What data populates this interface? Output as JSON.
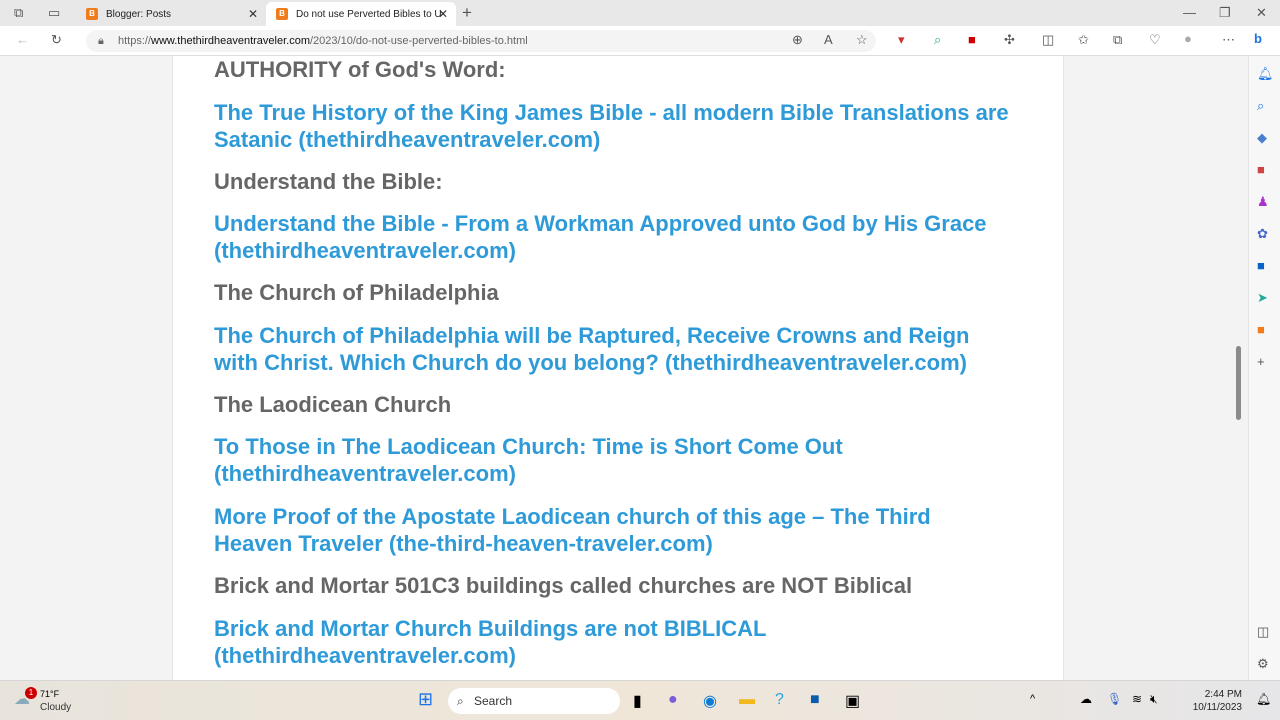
{
  "browser": {
    "tabs": [
      {
        "label": "Blogger: Posts",
        "active": false
      },
      {
        "label": "Do not use Perverted Bibles to U",
        "active": true
      }
    ],
    "url_prefix": "https://",
    "url_domain": "www.thethirdheaventraveler.com",
    "url_path": "/2023/10/do-not-use-perverted-bibles-to.html"
  },
  "content": [
    {
      "type": "heading",
      "text": "AUTHORITY of God's Word:"
    },
    {
      "type": "link",
      "text": "The True History of the King James Bible - all modern Bible Translations are Satanic (thethirdheaventraveler.com)"
    },
    {
      "type": "heading",
      "text": "Understand the Bible:"
    },
    {
      "type": "link",
      "text": "Understand the Bible - From a Workman Approved unto God by His Grace (thethirdheaventraveler.com)"
    },
    {
      "type": "heading",
      "text": "The Church of Philadelphia"
    },
    {
      "type": "link",
      "text": "The Church of Philadelphia will be Raptured, Receive Crowns and Reign with Christ. Which Church do you belong? (thethirdheaventraveler.com)"
    },
    {
      "type": "heading",
      "text": "The Laodicean Church"
    },
    {
      "type": "link",
      "text": "To Those in The Laodicean Church: Time is Short Come Out (thethirdheaventraveler.com)"
    },
    {
      "type": "link",
      "text": "More Proof of the Apostate Laodicean church of this age – The Third Heaven Traveler (the-third-heaven-traveler.com)"
    },
    {
      "type": "heading",
      "text": "Brick and Mortar 501C3 buildings called churches are NOT Biblical"
    },
    {
      "type": "link",
      "text": "Brick and Mortar Church Buildings are not BIBLICAL (thethirdheaventraveler.com)"
    }
  ],
  "taskbar": {
    "weather_temp": "71°F",
    "weather_desc": "Cloudy",
    "weather_badge": "1",
    "search_label": "Search",
    "time": "2:44 PM",
    "date": "10/11/2023"
  },
  "colors": {
    "link": "#2e9ad8",
    "heading": "#666666"
  }
}
